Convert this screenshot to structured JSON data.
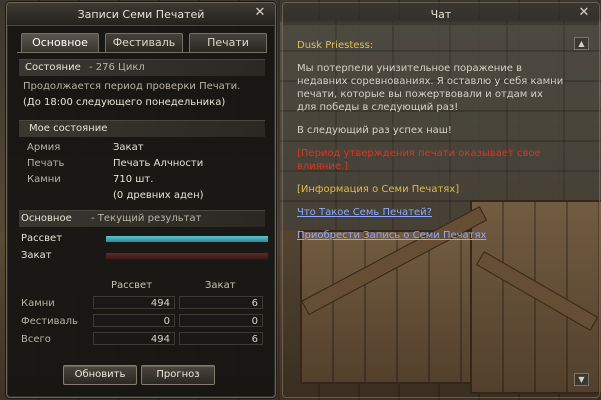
{
  "left": {
    "title": "Записи Семи Печатей",
    "tabs": [
      "Основное",
      "Фестиваль",
      "Печати"
    ],
    "status": {
      "label": "Состояние",
      "value": "- 276 Цикл"
    },
    "period_line1": "Продолжается период проверки Печати.",
    "period_line2": "(До 18:00 следующего понедельника)",
    "my_status": "Мое состояние",
    "rows": [
      {
        "label": "Армия",
        "value": "Закат"
      },
      {
        "label": "Печать",
        "value": "Печать Алчности"
      },
      {
        "label": "Камни",
        "value": "710 шт."
      },
      {
        "label": "",
        "value": "(0 древних аден)"
      }
    ],
    "result_head": {
      "left": "Основное",
      "right": "- Текущий результат"
    },
    "bars": [
      {
        "label": "Рассвет",
        "fill": 1.0
      },
      {
        "label": "Закат",
        "fill": 1.0
      }
    ],
    "table": {
      "headers": [
        "Рассвет",
        "Закат"
      ],
      "rows": [
        {
          "label": "Камни",
          "dawn": "494",
          "dusk": "6"
        },
        {
          "label": "Фестиваль",
          "dawn": "0",
          "dusk": "0"
        },
        {
          "label": "Всего",
          "dawn": "494",
          "dusk": "6"
        }
      ]
    },
    "buttons": {
      "refresh": "Обновить",
      "forecast": "Прогноз"
    }
  },
  "chat": {
    "title": "Чат",
    "speaker": "Dusk Priestess:",
    "msg1": "Мы потерпели унизительное поражение в недавних соревнованиях. Я оставлю у себя камни печати, которые вы пожертвовали и отдам их для победы в следующий раз!",
    "msg2": "В следующий раз успех наш!",
    "msg3": "[Период утверждения печати оказывает свое влияние.]",
    "msg4": "[Информация о Семи Печатях]",
    "link1": "Что Такое Семь Печатей?",
    "link2": "Приобрести Запись о Семи Печатях"
  },
  "colors": {
    "dawn": "#3aa8b5",
    "dusk": "#5a2b27",
    "red": "#d8361f",
    "gold": "#e0b94e",
    "link": "#8fa8ff"
  },
  "icons": {
    "close": "✕",
    "scroll_up": "▲",
    "scroll_down": "▼"
  }
}
